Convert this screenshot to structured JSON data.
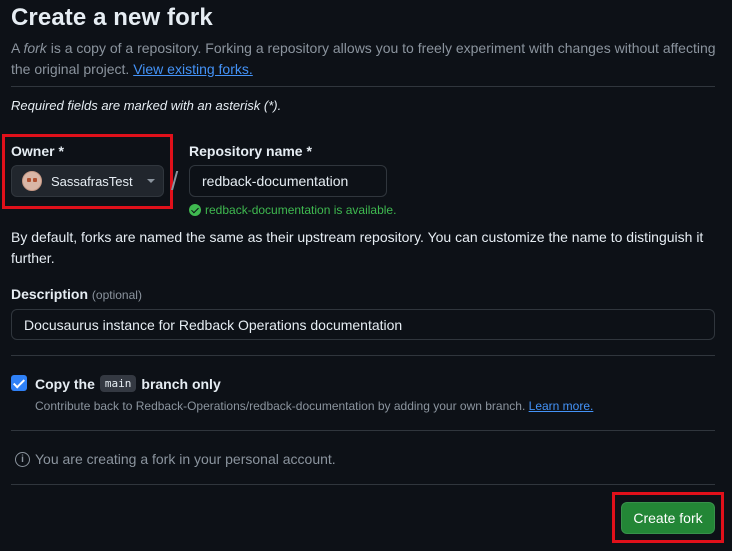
{
  "page": {
    "title": "Create a new fork",
    "intro_prefix": "A ",
    "intro_fork_word": "fork",
    "intro_text": " is a copy of a repository. Forking a repository allows you to freely experiment with changes without affecting the original project. ",
    "view_forks_link": "View existing forks."
  },
  "form": {
    "required_note": "Required fields are marked with an asterisk (*).",
    "owner_label": "Owner *",
    "owner_value": "SassafrasTest",
    "repo_label": "Repository name *",
    "repo_value": "redback-documentation",
    "repo_available": "redback-documentation is available.",
    "naming_note": "By default, forks are named the same as their upstream repository. You can customize the name to distinguish it further.",
    "description_label": "Description",
    "description_optional": "(optional)",
    "description_value": "Docusaurus instance for Redback Operations documentation",
    "copy_prefix": "Copy the",
    "copy_branch": "main",
    "copy_suffix": "branch only",
    "copy_checked": true,
    "contribute_text": "Contribute back to Redback-Operations/redback-documentation by adding your own branch.",
    "learn_more_link": "Learn more.",
    "personal_account_note": "You are creating a fork in your personal account.",
    "create_button": "Create fork"
  },
  "colors": {
    "background": "#0d1117",
    "accent_link": "#4493f8",
    "success": "#3fb950",
    "primary_button": "#238636",
    "highlight": "#e0101a"
  },
  "icons": {
    "owner_dropdown": "chevron-down-icon",
    "available": "check-circle-icon",
    "info": "info-icon"
  }
}
